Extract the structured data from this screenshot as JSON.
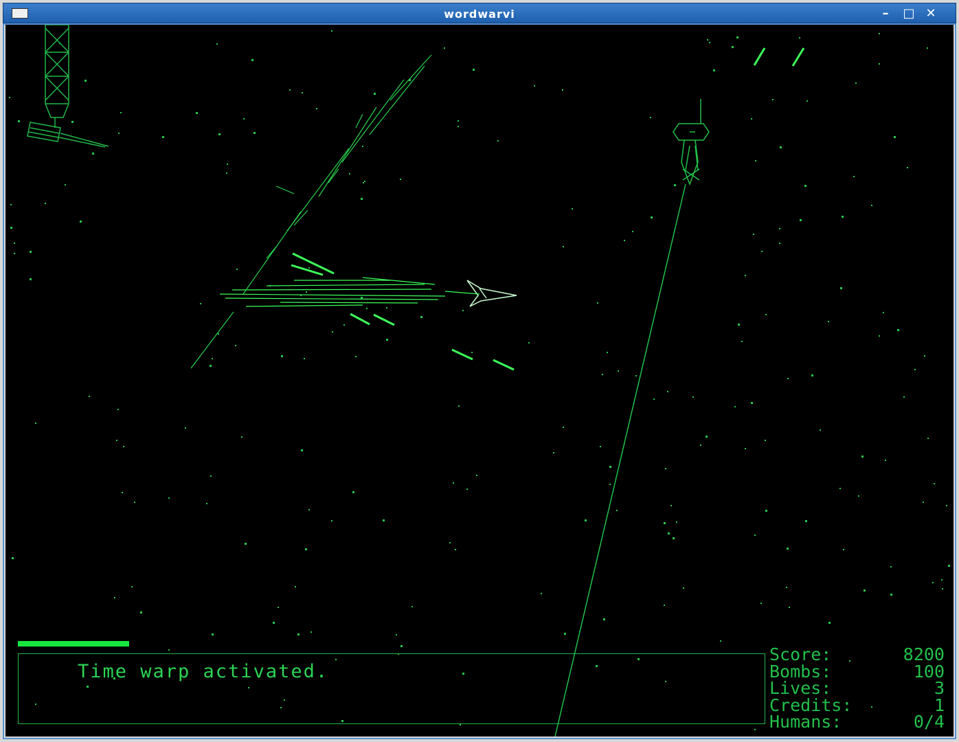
{
  "window": {
    "title": "wordwarvi",
    "minimize_glyph": "–",
    "maximize_glyph": "□",
    "close_glyph": "✕"
  },
  "message": "Time warp activated.",
  "energy_level_fraction": 0.12,
  "hud": {
    "score_label": "Score:",
    "score_value": "8200",
    "bombs_label": "Bombs:",
    "bombs_value": "100",
    "lives_label": "Lives:",
    "lives_value": "3",
    "credits_label": "Credits:",
    "credits_value": "1",
    "humans_label": "Humans:",
    "humans_value": "0/4"
  },
  "colors": {
    "vector_green": "#21c24b",
    "bright_green": "#3cff5a",
    "ship_white_green": "#c8ffd0",
    "background": "#000000",
    "titlebar_blue": "#2a6fbf"
  }
}
